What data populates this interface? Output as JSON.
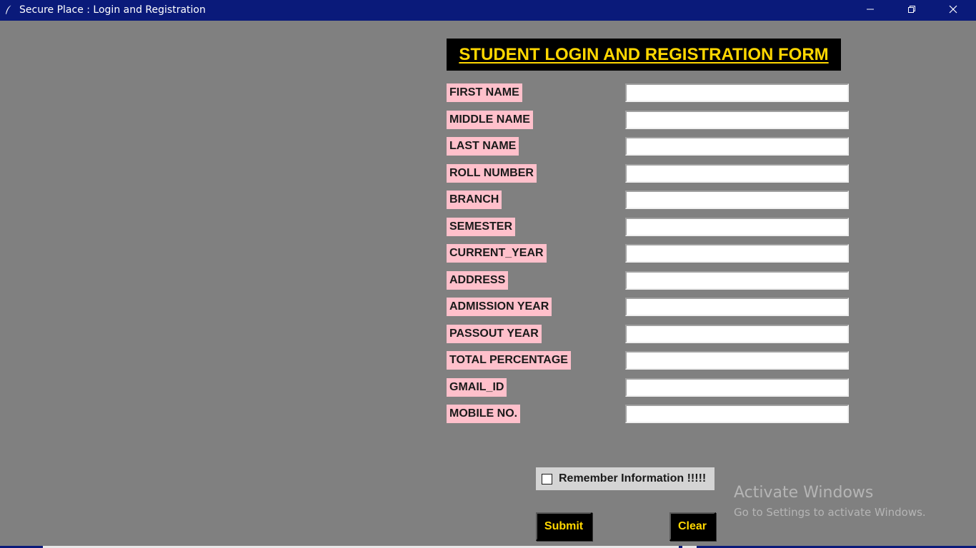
{
  "window": {
    "title": "Secure Place : Login and Registration",
    "titlebar_color": "#0a1a7a",
    "background_color": "#808080"
  },
  "form": {
    "heading": "STUDENT LOGIN AND REGISTRATION FORM",
    "heading_color": "#ffd700",
    "label_bg_color": "#ffc0cb",
    "fields": [
      {
        "label": "FIRST NAME",
        "value": ""
      },
      {
        "label": "MIDDLE NAME",
        "value": ""
      },
      {
        "label": "LAST NAME",
        "value": ""
      },
      {
        "label": "ROLL NUMBER",
        "value": ""
      },
      {
        "label": "BRANCH",
        "value": ""
      },
      {
        "label": "SEMESTER",
        "value": ""
      },
      {
        "label": "CURRENT_YEAR",
        "value": ""
      },
      {
        "label": "ADDRESS",
        "value": ""
      },
      {
        "label": "ADMISSION YEAR",
        "value": ""
      },
      {
        "label": "PASSOUT YEAR",
        "value": ""
      },
      {
        "label": "TOTAL PERCENTAGE",
        "value": ""
      },
      {
        "label": "GMAIL_ID",
        "value": ""
      },
      {
        "label": "MOBILE NO.",
        "value": ""
      }
    ],
    "remember": {
      "label": "Remember Information !!!!!",
      "checked": false
    },
    "buttons": {
      "submit_label": "Submit",
      "clear_label": "Clear"
    }
  },
  "watermark": {
    "title": "Activate Windows",
    "subtitle": "Go to Settings to activate Windows."
  },
  "icons": {
    "app": "feather-icon",
    "minimize": "minimize-icon",
    "maximize": "restore-icon",
    "close": "close-icon"
  }
}
